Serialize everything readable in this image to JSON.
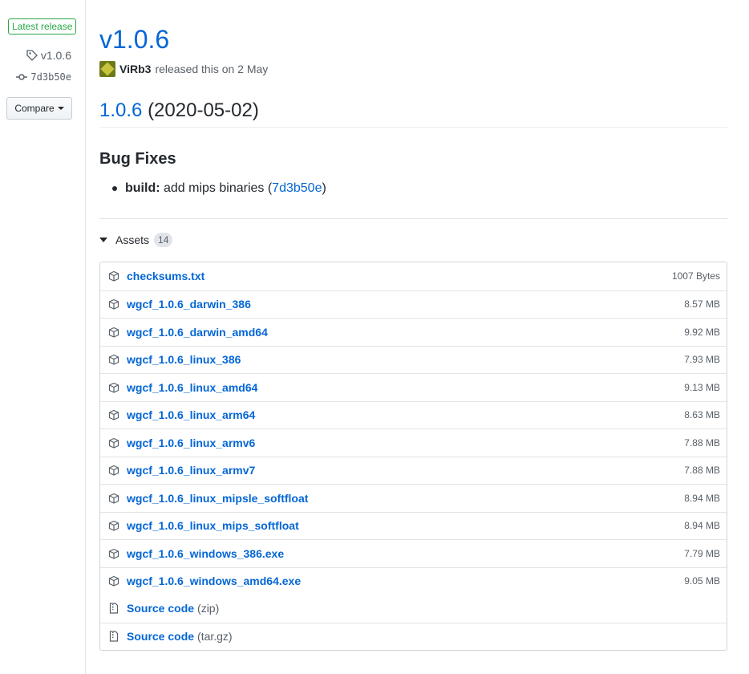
{
  "sidebar": {
    "badge": "Latest release",
    "tag": "v1.0.6",
    "commit": "7d3b50e",
    "compare_label": "Compare"
  },
  "release": {
    "title": "v1.0.6",
    "author": "ViRb3",
    "released_text": "released this on 2 May"
  },
  "notes": {
    "version_link": "1.0.6",
    "version_date": "(2020-05-02)",
    "section_title": "Bug Fixes",
    "item_bold": "build:",
    "item_text": "add mips binaries (",
    "item_commit": "7d3b50e",
    "item_close": ")"
  },
  "assets": {
    "label": "Assets",
    "count": "14",
    "files": [
      {
        "name": "checksums.txt",
        "size": "1007 Bytes"
      },
      {
        "name": "wgcf_1.0.6_darwin_386",
        "size": "8.57 MB"
      },
      {
        "name": "wgcf_1.0.6_darwin_amd64",
        "size": "9.92 MB"
      },
      {
        "name": "wgcf_1.0.6_linux_386",
        "size": "7.93 MB"
      },
      {
        "name": "wgcf_1.0.6_linux_amd64",
        "size": "9.13 MB"
      },
      {
        "name": "wgcf_1.0.6_linux_arm64",
        "size": "8.63 MB"
      },
      {
        "name": "wgcf_1.0.6_linux_armv6",
        "size": "7.88 MB"
      },
      {
        "name": "wgcf_1.0.6_linux_armv7",
        "size": "7.88 MB"
      },
      {
        "name": "wgcf_1.0.6_linux_mipsle_softfloat",
        "size": "8.94 MB"
      },
      {
        "name": "wgcf_1.0.6_linux_mips_softfloat",
        "size": "8.94 MB"
      },
      {
        "name": "wgcf_1.0.6_windows_386.exe",
        "size": "7.79 MB"
      },
      {
        "name": "wgcf_1.0.6_windows_amd64.exe",
        "size": "9.05 MB"
      }
    ],
    "source": [
      {
        "name": "Source code",
        "ext": "(zip)"
      },
      {
        "name": "Source code",
        "ext": "(tar.gz)"
      }
    ]
  },
  "colors": {
    "link": "#0366d6",
    "badge_green": "#28a745",
    "muted": "#586069"
  }
}
